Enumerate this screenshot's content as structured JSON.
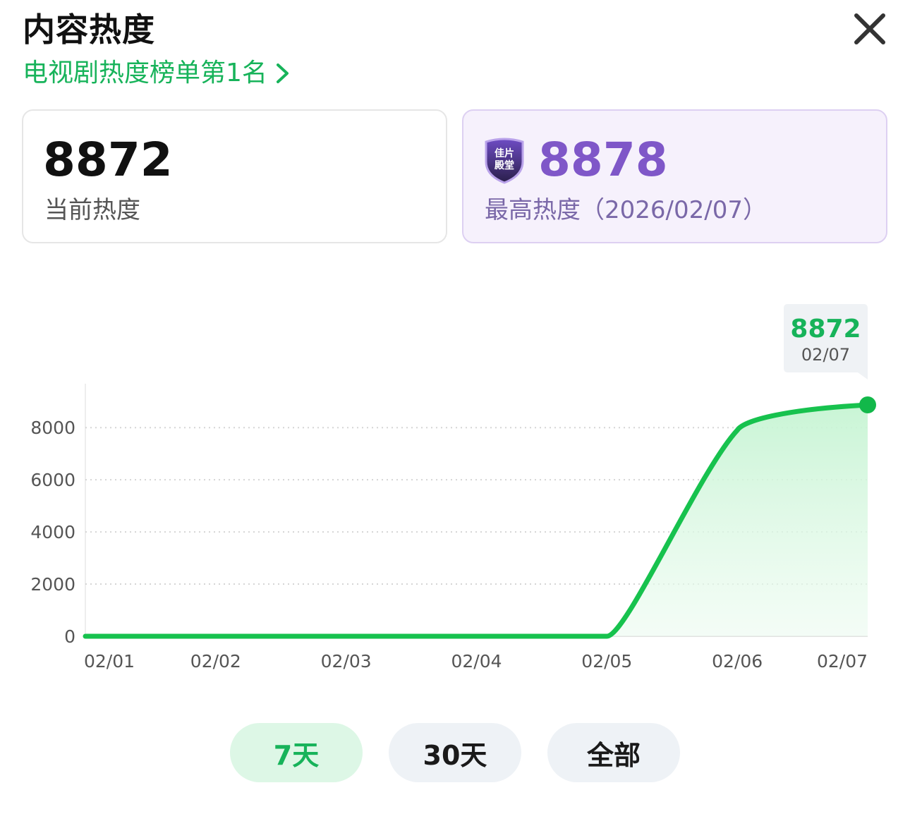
{
  "header": {
    "title": "内容热度",
    "rank_link": "电视剧热度榜单第1名"
  },
  "stats": {
    "current": {
      "value": "8872",
      "label": "当前热度"
    },
    "peak": {
      "value": "8878",
      "label": "最高热度（2026/02/07）",
      "badge_text": "佳片殿堂"
    }
  },
  "chart_data": {
    "type": "area",
    "categories": [
      "02/01",
      "02/02",
      "02/03",
      "02/04",
      "02/05",
      "02/06",
      "02/07"
    ],
    "values": [
      0,
      0,
      0,
      0,
      0,
      7900,
      8872
    ],
    "ylim": [
      0,
      8872
    ],
    "yticks": [
      0,
      2000,
      4000,
      6000,
      8000
    ],
    "grid": true,
    "line_color": "#17c24e",
    "tooltip": {
      "value": "8872",
      "date": "02/07"
    }
  },
  "range_tabs": [
    {
      "label": "7天",
      "active": true
    },
    {
      "label": "30天",
      "active": false
    },
    {
      "label": "全部",
      "active": false
    }
  ],
  "colors": {
    "accent_green": "#17b35a",
    "peak_purple": "#7f57c8"
  }
}
